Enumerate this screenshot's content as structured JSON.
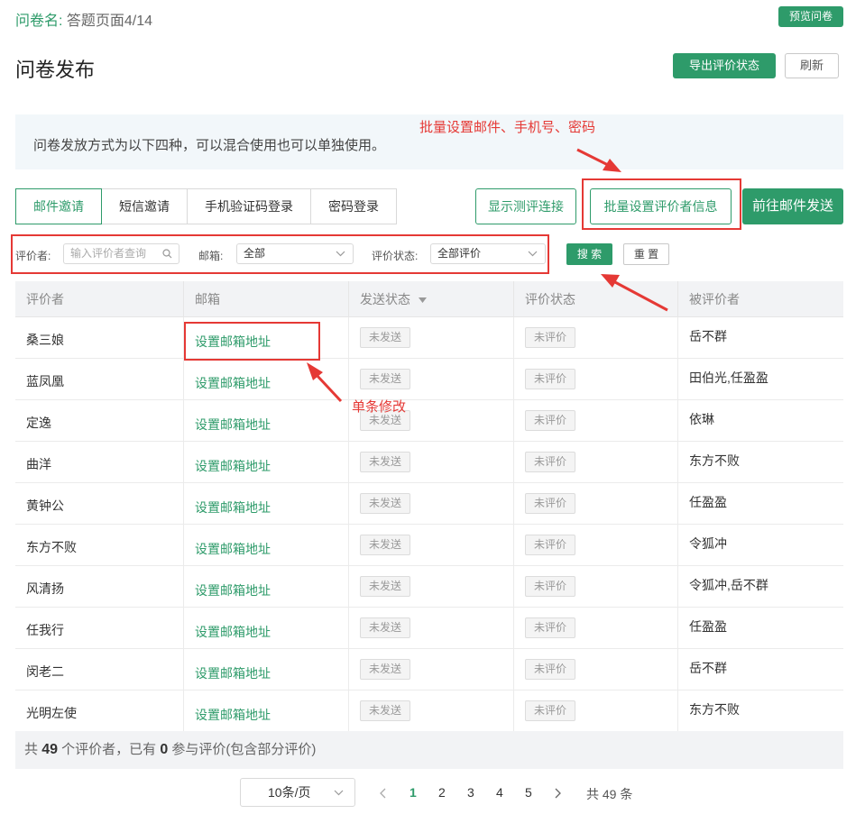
{
  "header": {
    "survey_label": "问卷名:",
    "survey_name": "答题页面4/14",
    "preview_btn": "预览问卷",
    "page_title": "问卷发布",
    "export_btn": "导出评价状态",
    "refresh_btn": "刷新"
  },
  "info": {
    "text": "问卷发放方式为以下四种，可以混合使用也可以单独使用。"
  },
  "tabs": [
    "邮件邀请",
    "短信邀请",
    "手机验证码登录",
    "密码登录"
  ],
  "actions": {
    "show_link": "显示测评连接",
    "batch_set": "批量设置评价者信息",
    "goto_send": "前往邮件发送"
  },
  "filter": {
    "rater_label": "评价者:",
    "rater_placeholder": "输入评价者查询",
    "email_label": "邮箱:",
    "email_value": "全部",
    "status_label": "评价状态:",
    "status_value": "全部评价",
    "search_btn": "搜 索",
    "reset_btn": "重 置"
  },
  "table": {
    "headers": [
      "评价者",
      "邮箱",
      "发送状态",
      "评价状态",
      "被评价者"
    ],
    "rows": [
      {
        "rater": "桑三娘",
        "email": "设置邮箱地址",
        "send": "未发送",
        "status": "未评价",
        "target": "岳不群"
      },
      {
        "rater": "蓝凤凰",
        "email": "设置邮箱地址",
        "send": "未发送",
        "status": "未评价",
        "target": "田伯光,任盈盈"
      },
      {
        "rater": "定逸",
        "email": "设置邮箱地址",
        "send": "未发送",
        "status": "未评价",
        "target": "依琳"
      },
      {
        "rater": "曲洋",
        "email": "设置邮箱地址",
        "send": "未发送",
        "status": "未评价",
        "target": "东方不败"
      },
      {
        "rater": "黄钟公",
        "email": "设置邮箱地址",
        "send": "未发送",
        "status": "未评价",
        "target": "任盈盈"
      },
      {
        "rater": "东方不败",
        "email": "设置邮箱地址",
        "send": "未发送",
        "status": "未评价",
        "target": "令狐冲"
      },
      {
        "rater": "风清扬",
        "email": "设置邮箱地址",
        "send": "未发送",
        "status": "未评价",
        "target": "令狐冲,岳不群"
      },
      {
        "rater": "任我行",
        "email": "设置邮箱地址",
        "send": "未发送",
        "status": "未评价",
        "target": "任盈盈"
      },
      {
        "rater": "闵老二",
        "email": "设置邮箱地址",
        "send": "未发送",
        "status": "未评价",
        "target": "岳不群"
      },
      {
        "rater": "光明左使",
        "email": "设置邮箱地址",
        "send": "未发送",
        "status": "未评价",
        "target": "东方不败"
      }
    ]
  },
  "summary": {
    "prefix": "共",
    "total": "49",
    "mid": "个评价者，已有",
    "rated": "0",
    "suffix": "参与评价(包含部分评价)"
  },
  "pagination": {
    "page_size": "10条/页",
    "pages": [
      "1",
      "2",
      "3",
      "4",
      "5"
    ],
    "current": "1",
    "total_text": "共 49 条"
  },
  "annotations": {
    "batch_note": "批量设置邮件、手机号、密码",
    "single_note": "单条修改"
  },
  "colors": {
    "accent": "#2e9b6a",
    "annotation": "#e53935"
  }
}
